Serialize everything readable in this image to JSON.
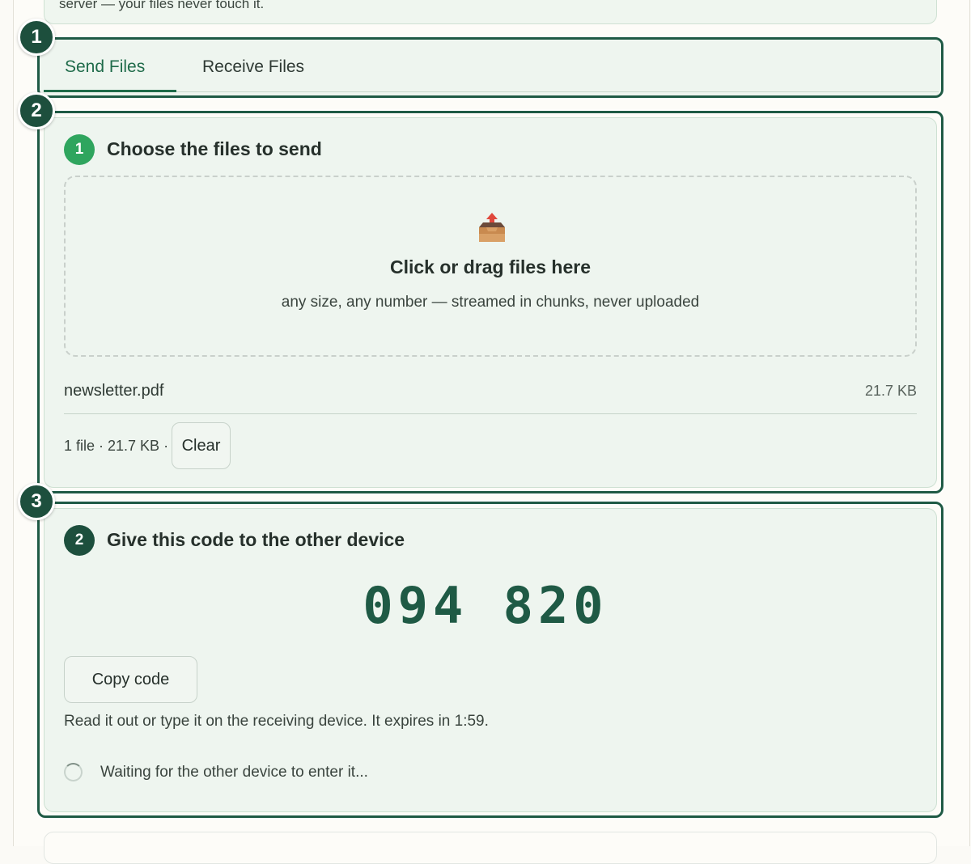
{
  "intro": {
    "text": "server — your files never touch it."
  },
  "callouts": [
    "1",
    "2",
    "3"
  ],
  "tabs": [
    {
      "label": "Send Files",
      "active": true
    },
    {
      "label": "Receive Files",
      "active": false
    }
  ],
  "step1": {
    "number": "1",
    "title": "Choose the files to send",
    "dropzone": {
      "icon": "inbox-upload-icon",
      "title": "Click or drag files here",
      "subtitle": "any size, any number — streamed in chunks, never uploaded"
    },
    "files": [
      {
        "name": "newsletter.pdf",
        "size": "21.7 KB"
      }
    ],
    "summary": "1 file · 21.7 KB ·",
    "clear_label": "Clear"
  },
  "step2": {
    "number": "2",
    "title": "Give this code to the other device",
    "code": "094 820",
    "copy_label": "Copy code",
    "hint": "Read it out or type it on the receiving device. It expires in 1:59.",
    "waiting": "Waiting for the other device to enter it..."
  },
  "colors": {
    "accent": "#1f5a45",
    "step_active": "#2fa55e",
    "panel_bg": "#eef5ef"
  }
}
